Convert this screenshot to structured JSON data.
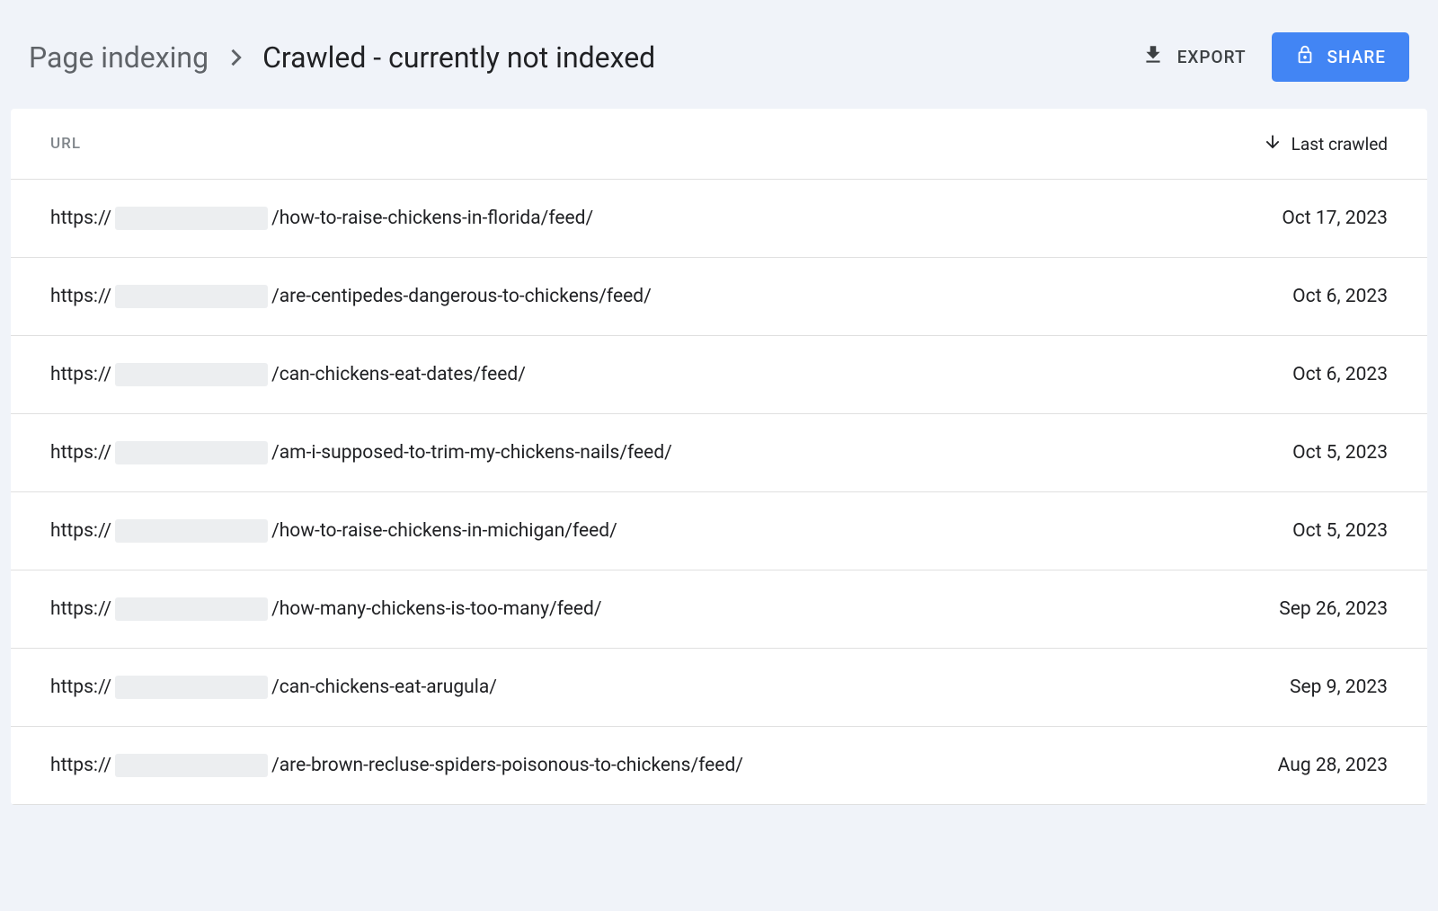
{
  "breadcrumb": {
    "root": "Page indexing",
    "current": "Crawled - currently not indexed"
  },
  "actions": {
    "export_label": "EXPORT",
    "share_label": "SHARE"
  },
  "table": {
    "columns": {
      "url": "URL",
      "last_crawled": "Last crawled"
    },
    "rows": [
      {
        "url_prefix": "https://",
        "url_path": "/how-to-raise-chickens-in-florida/feed/",
        "date": "Oct 17, 2023"
      },
      {
        "url_prefix": "https://",
        "url_path": "/are-centipedes-dangerous-to-chickens/feed/",
        "date": "Oct 6, 2023"
      },
      {
        "url_prefix": "https://",
        "url_path": "/can-chickens-eat-dates/feed/",
        "date": "Oct 6, 2023"
      },
      {
        "url_prefix": "https://",
        "url_path": "/am-i-supposed-to-trim-my-chickens-nails/feed/",
        "date": "Oct 5, 2023"
      },
      {
        "url_prefix": "https://",
        "url_path": "/how-to-raise-chickens-in-michigan/feed/",
        "date": "Oct 5, 2023"
      },
      {
        "url_prefix": "https://",
        "url_path": "/how-many-chickens-is-too-many/feed/",
        "date": "Sep 26, 2023"
      },
      {
        "url_prefix": "https://",
        "url_path": "/can-chickens-eat-arugula/",
        "date": "Sep 9, 2023"
      },
      {
        "url_prefix": "https://",
        "url_path": "/are-brown-recluse-spiders-poisonous-to-chickens/feed/",
        "date": "Aug 28, 2023"
      }
    ]
  }
}
